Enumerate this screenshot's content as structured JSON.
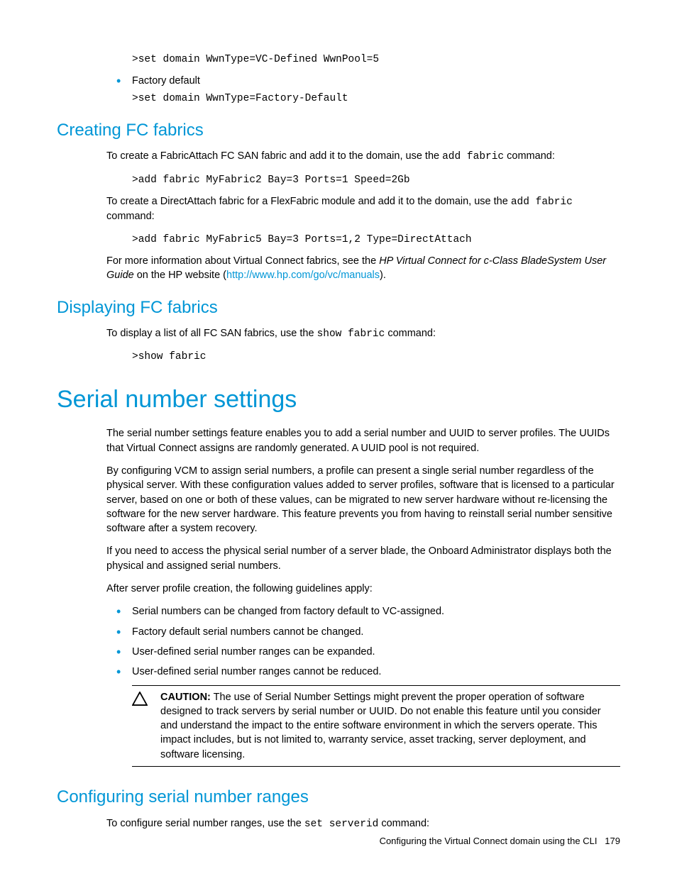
{
  "top": {
    "code1": ">set domain WwnType=VC-Defined WwnPool=5",
    "bullet1": "Factory default",
    "code2": ">set domain WwnType=Factory-Default"
  },
  "creating": {
    "heading": "Creating FC fabrics",
    "p1_a": "To create a FabricAttach FC SAN fabric and add it to the domain, use the ",
    "p1_code": "add fabric",
    "p1_b": " command:",
    "code1": ">add fabric MyFabric2 Bay=3 Ports=1 Speed=2Gb",
    "p2_a": "To create a DirectAttach fabric for a FlexFabric module and add it to the domain, use the ",
    "p2_code": "add fabric",
    "p2_b": " command:",
    "code2": ">add fabric MyFabric5 Bay=3 Ports=1,2 Type=DirectAttach",
    "p3_a": "For more information about Virtual Connect fabrics, see the ",
    "p3_i": "HP Virtual Connect for c-Class BladeSystem User Guide",
    "p3_b": " on the HP website (",
    "p3_link": "http://www.hp.com/go/vc/manuals",
    "p3_c": ")."
  },
  "displaying": {
    "heading": "Displaying FC fabrics",
    "p1_a": "To display a list of all FC SAN fabrics, use the ",
    "p1_code": "show fabric",
    "p1_b": " command:",
    "code1": ">show fabric"
  },
  "serial": {
    "heading": "Serial number settings",
    "p1": "The serial number settings feature enables you to add a serial number and UUID to server profiles. The UUIDs that Virtual Connect assigns are randomly generated. A UUID pool is not required.",
    "p2": "By configuring VCM to assign serial numbers, a profile can present a single serial number regardless of the physical server. With these configuration values added to server profiles, software that is licensed to a particular server, based on one or both of these values, can be migrated to new server hardware without re-licensing the software for the new server hardware. This feature prevents you from having to reinstall serial number sensitive software after a system recovery.",
    "p3": "If you need to access the physical serial number of a server blade, the Onboard Administrator displays both the physical and assigned serial numbers.",
    "p4": "After server profile creation, the following guidelines apply:",
    "bullets": [
      "Serial numbers can be changed from factory default to VC-assigned.",
      "Factory default serial numbers cannot be changed.",
      "User-defined serial number ranges can be expanded.",
      "User-defined serial number ranges cannot be reduced."
    ],
    "caution_label": "CAUTION:",
    "caution_text": "  The use of Serial Number Settings might prevent the proper operation of software designed to track servers by serial number or UUID. Do not enable this feature until you consider and understand the impact to the entire software environment in which the servers operate. This impact includes, but is not limited to, warranty service, asset tracking, server deployment, and software licensing."
  },
  "configuring": {
    "heading": "Configuring serial number ranges",
    "p1_a": "To configure serial number ranges, use the ",
    "p1_code": "set serverid",
    "p1_b": " command:"
  },
  "footer": {
    "text": "Configuring the Virtual Connect domain using the CLI",
    "page": "179"
  }
}
